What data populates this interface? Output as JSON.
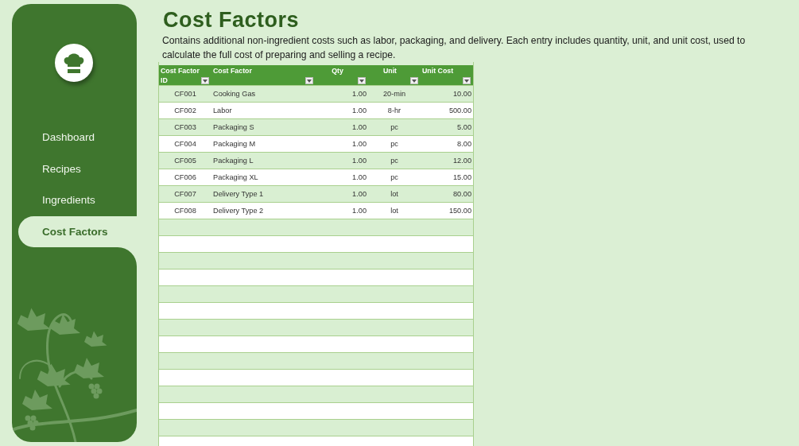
{
  "sidebar": {
    "items": [
      {
        "label": "Dashboard",
        "selected": false
      },
      {
        "label": "Recipes",
        "selected": false
      },
      {
        "label": "Ingredients",
        "selected": false
      },
      {
        "label": "Cost Factors",
        "selected": true
      }
    ]
  },
  "page": {
    "title": "Cost Factors",
    "description": "Contains additional non-ingredient costs such as labor, packaging, and delivery. Each entry includes quantity, unit, and unit cost, used to calculate the full cost of preparing and selling a recipe."
  },
  "table": {
    "columns": [
      "Cost Factor ID",
      "Cost Factor",
      "Qty",
      "Unit",
      "Unit Cost"
    ],
    "rows": [
      [
        "CF001",
        "Cooking Gas",
        "1.00",
        "20-min",
        "10.00"
      ],
      [
        "CF002",
        "Labor",
        "1.00",
        "8-hr",
        "500.00"
      ],
      [
        "CF003",
        "Packaging S",
        "1.00",
        "pc",
        "5.00"
      ],
      [
        "CF004",
        "Packaging M",
        "1.00",
        "pc",
        "8.00"
      ],
      [
        "CF005",
        "Packaging L",
        "1.00",
        "pc",
        "12.00"
      ],
      [
        "CF006",
        "Packaging XL",
        "1.00",
        "pc",
        "15.00"
      ],
      [
        "CF007",
        "Delivery Type 1",
        "1.00",
        "lot",
        "80.00"
      ],
      [
        "CF008",
        "Delivery Type 2",
        "1.00",
        "lot",
        "150.00"
      ]
    ]
  }
}
